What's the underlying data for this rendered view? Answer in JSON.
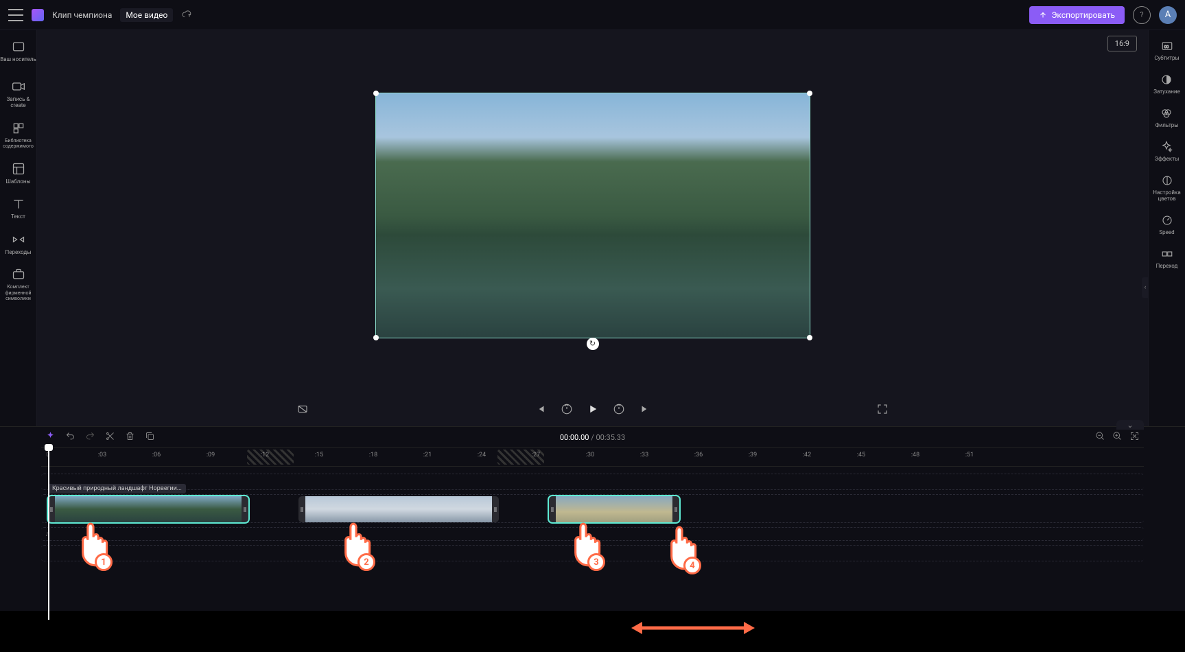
{
  "header": {
    "app_title": "Клип чемпиона",
    "project_name": "Мое видео",
    "export_label": "Экспортировать",
    "avatar_initial": "A"
  },
  "left_sidebar": {
    "items": [
      {
        "label": "Ваш носитель"
      },
      {
        "label": "Запись &amp; create"
      },
      {
        "label": "Библиотека содержимого"
      },
      {
        "label": "Шаблоны"
      },
      {
        "label": "Текст"
      },
      {
        "label": "Переходы"
      },
      {
        "label": "Комплект фирменной символики"
      }
    ]
  },
  "right_sidebar": {
    "items": [
      {
        "label": "Субтитры"
      },
      {
        "label": "Затухание"
      },
      {
        "label": "Фильтры"
      },
      {
        "label": "Эффекты"
      },
      {
        "label": "Настройка цветов"
      },
      {
        "label": "Speed"
      },
      {
        "label": "Переход"
      }
    ]
  },
  "preview": {
    "aspect_ratio": "16:9"
  },
  "playback": {
    "current_time": "00:00.00",
    "total_time": "00:35.33"
  },
  "ruler": {
    "ticks": [
      "0",
      ":03",
      ":06",
      ":09",
      ":12",
      ":15",
      ":18",
      ":21",
      ":24",
      ":27",
      ":30",
      ":33",
      ":36",
      ":39",
      ":42",
      ":45",
      ":48",
      ":51"
    ]
  },
  "clips": {
    "selected_label": "Красивый природный ландшафт Норвегии..."
  },
  "tutorial": {
    "badges": [
      "1",
      "2",
      "3",
      "4"
    ]
  }
}
